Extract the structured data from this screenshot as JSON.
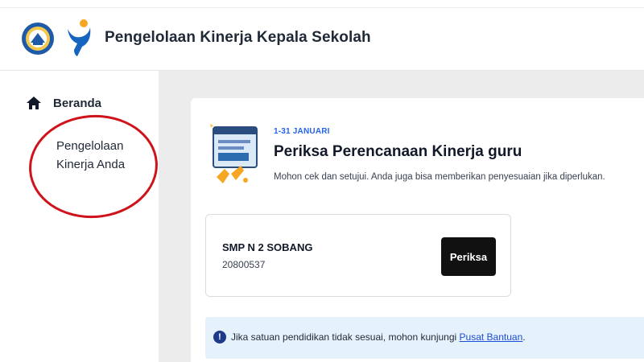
{
  "header": {
    "title": "Pengelolaan Kinerja Kepala Sekolah",
    "logos": [
      "kemdikbud-logo",
      "app-logo"
    ]
  },
  "sidebar": {
    "items": [
      {
        "label": "Beranda",
        "icon": "home-icon"
      },
      {
        "label": "Pengelolaan Kinerja Anda"
      }
    ],
    "highlight_color": "#d0121b"
  },
  "card": {
    "period": "1-31 JANUARI",
    "title": "Periksa Perencanaan Kinerja guru",
    "description": "Mohon cek dan setujui. Anda juga bisa memberikan penyesuaian jika diperlukan.",
    "school": {
      "name": "SMP N 2 SOBANG",
      "npsn": "20800537",
      "button_label": "Periksa"
    },
    "info": {
      "text": "Jika satuan pendidikan tidak sesuai, mohon kunjungi ",
      "link_text": "Pusat Bantuan",
      "suffix": "."
    }
  },
  "colors": {
    "accent_blue": "#2563eb",
    "button_dark": "#111111",
    "info_bg": "#e5f1fb"
  }
}
